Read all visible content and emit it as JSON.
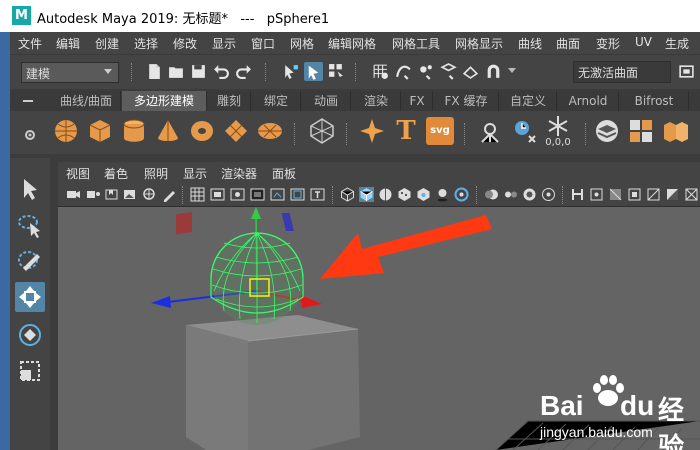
{
  "window": {
    "app_icon_letter": "M",
    "title": "Autodesk Maya 2019: 无标题*   ---   pSphere1"
  },
  "menu": [
    "文件",
    "编辑",
    "创建",
    "选择",
    "修改",
    "显示",
    "窗口",
    "网格",
    "编辑网格",
    "网格工具",
    "网格显示",
    "曲线",
    "曲面",
    "变形",
    "UV",
    "生成"
  ],
  "status": {
    "mode_dropdown": "建模",
    "live_surface": "无激活曲面"
  },
  "shelf": {
    "tabs": [
      "曲线/曲面",
      "多边形建模",
      "雕刻",
      "绑定",
      "动画",
      "渲染",
      "FX",
      "FX 缓存",
      "自定义",
      "Arnold",
      "Bifrost"
    ],
    "active_tab_index": 1,
    "text_icon": "T",
    "svg_icon": "svg",
    "cluster_label": "0,0,0"
  },
  "panel": {
    "menu": [
      "视图",
      "着色",
      "照明",
      "显示",
      "渲染器",
      "面板"
    ]
  },
  "watermark": {
    "logo_bai": "Bai",
    "logo_du": "du",
    "logo_jingyan": "经验",
    "url": "jingyan.baidu.com"
  },
  "colors": {
    "active_tab": "#5d5d5d",
    "active_tool": "#5285a6",
    "selection_green": "#33ff66",
    "arrow_red": "#ff3a12",
    "viewport_bg": "#646464"
  }
}
